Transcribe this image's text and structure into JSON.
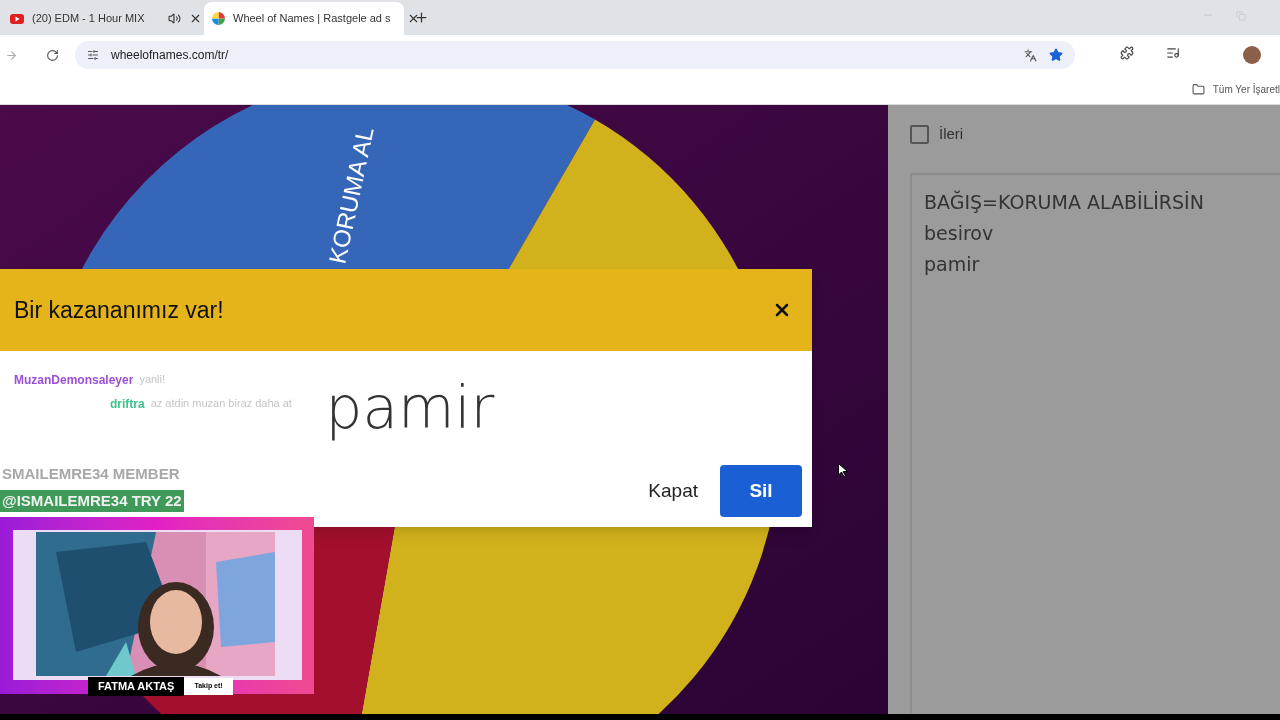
{
  "browser": {
    "tabs": [
      {
        "title": "(20) EDM - 1 Hour MIX",
        "selected": false,
        "audio": true
      },
      {
        "title": "Wheel of Names | Rastgele ad s",
        "selected": true,
        "audio": false
      }
    ],
    "url": "wheelofnames.com/tr/",
    "bookmarks_folder": "Tüm Yer İşaretl"
  },
  "wheel": {
    "label": "KORUMA AL",
    "segments": [
      {
        "color": "#3566b8"
      },
      {
        "color": "#d2b21c"
      },
      {
        "color": "#a3102e"
      }
    ]
  },
  "options": [
    {
      "label": "İleri",
      "checked": false
    }
  ],
  "entries": [
    "BAĞIŞ=KORUMA ALABİLİRSİN",
    "besirov",
    "pamir"
  ],
  "dialog": {
    "title": "Bir kazananımız var!",
    "winner": "pamir",
    "buttons": [
      {
        "label": "Kapat",
        "kind": "text"
      },
      {
        "label": "Sil",
        "kind": "primary"
      }
    ]
  },
  "stream_overlay": {
    "chat": [
      {
        "user": "MuzanDemonsaleyer",
        "color": "#9b4fd6",
        "message": "yanli!"
      },
      {
        "user": "driftra",
        "color": "#3cc48a",
        "message": "az atdin muzan biraz daha at"
      }
    ],
    "alerts": [
      {
        "text": "SMAILEMRE34 MEMBER",
        "kind": "faded"
      },
      {
        "text": "@ISMAILEMRE34 TRY 22",
        "kind": "highlight"
      }
    ],
    "webcam": {
      "kind": "picture",
      "name": "FATMA AKTAŞ",
      "follow": "Takip et!"
    }
  }
}
